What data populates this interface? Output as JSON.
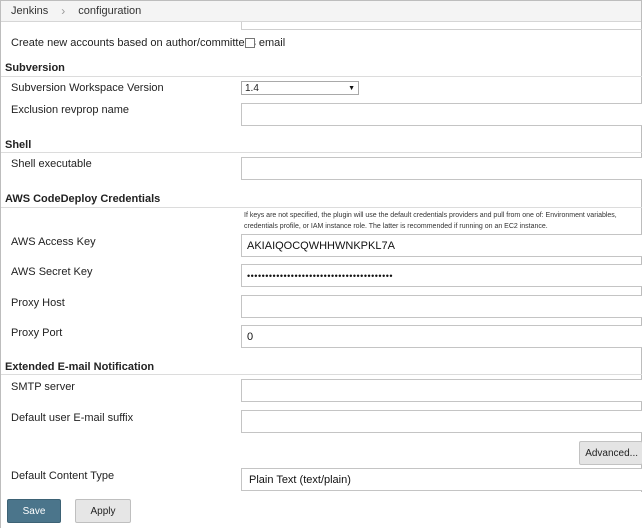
{
  "breadcrumb": {
    "items": [
      "Jenkins",
      "configuration"
    ],
    "separator": "›"
  },
  "accounts": {
    "label": "Create new accounts based on author/committer's email",
    "checked": false
  },
  "subversion": {
    "title": "Subversion",
    "workspace_version_label": "Subversion Workspace Version",
    "workspace_version_value": "1.4",
    "exclusion_label": "Exclusion revprop name",
    "exclusion_value": ""
  },
  "shell": {
    "title": "Shell",
    "executable_label": "Shell executable",
    "executable_value": ""
  },
  "aws": {
    "title": "AWS CodeDeploy Credentials",
    "help_line1": "If keys are not specified, the plugin will use the default credentials providers and pull from one of: Environment variables,",
    "help_line2": "credentials profile, or IAM instance role. The latter is recommended if running on an EC2 instance.",
    "access_key_label": "AWS Access Key",
    "access_key_value": "AKIAIQOCQWHHWNKPKL7A",
    "secret_key_label": "AWS Secret Key",
    "secret_key_value": "••••••••••••••••••••••••••••••••••••••••",
    "proxy_host_label": "Proxy Host",
    "proxy_host_value": "",
    "proxy_port_label": "Proxy Port",
    "proxy_port_value": "0"
  },
  "email": {
    "title": "Extended E-mail Notification",
    "smtp_label": "SMTP server",
    "smtp_value": "",
    "suffix_label": "Default user E-mail suffix",
    "suffix_value": "",
    "advanced_label": "Advanced...",
    "content_type_label": "Default Content Type",
    "content_type_value": "Plain Text (text/plain)"
  },
  "actions": {
    "save_label": "Save",
    "apply_label": "Apply"
  },
  "colors": {
    "save_button": "#4b758b",
    "breadcrumb_bg": "#f4f4f4"
  }
}
